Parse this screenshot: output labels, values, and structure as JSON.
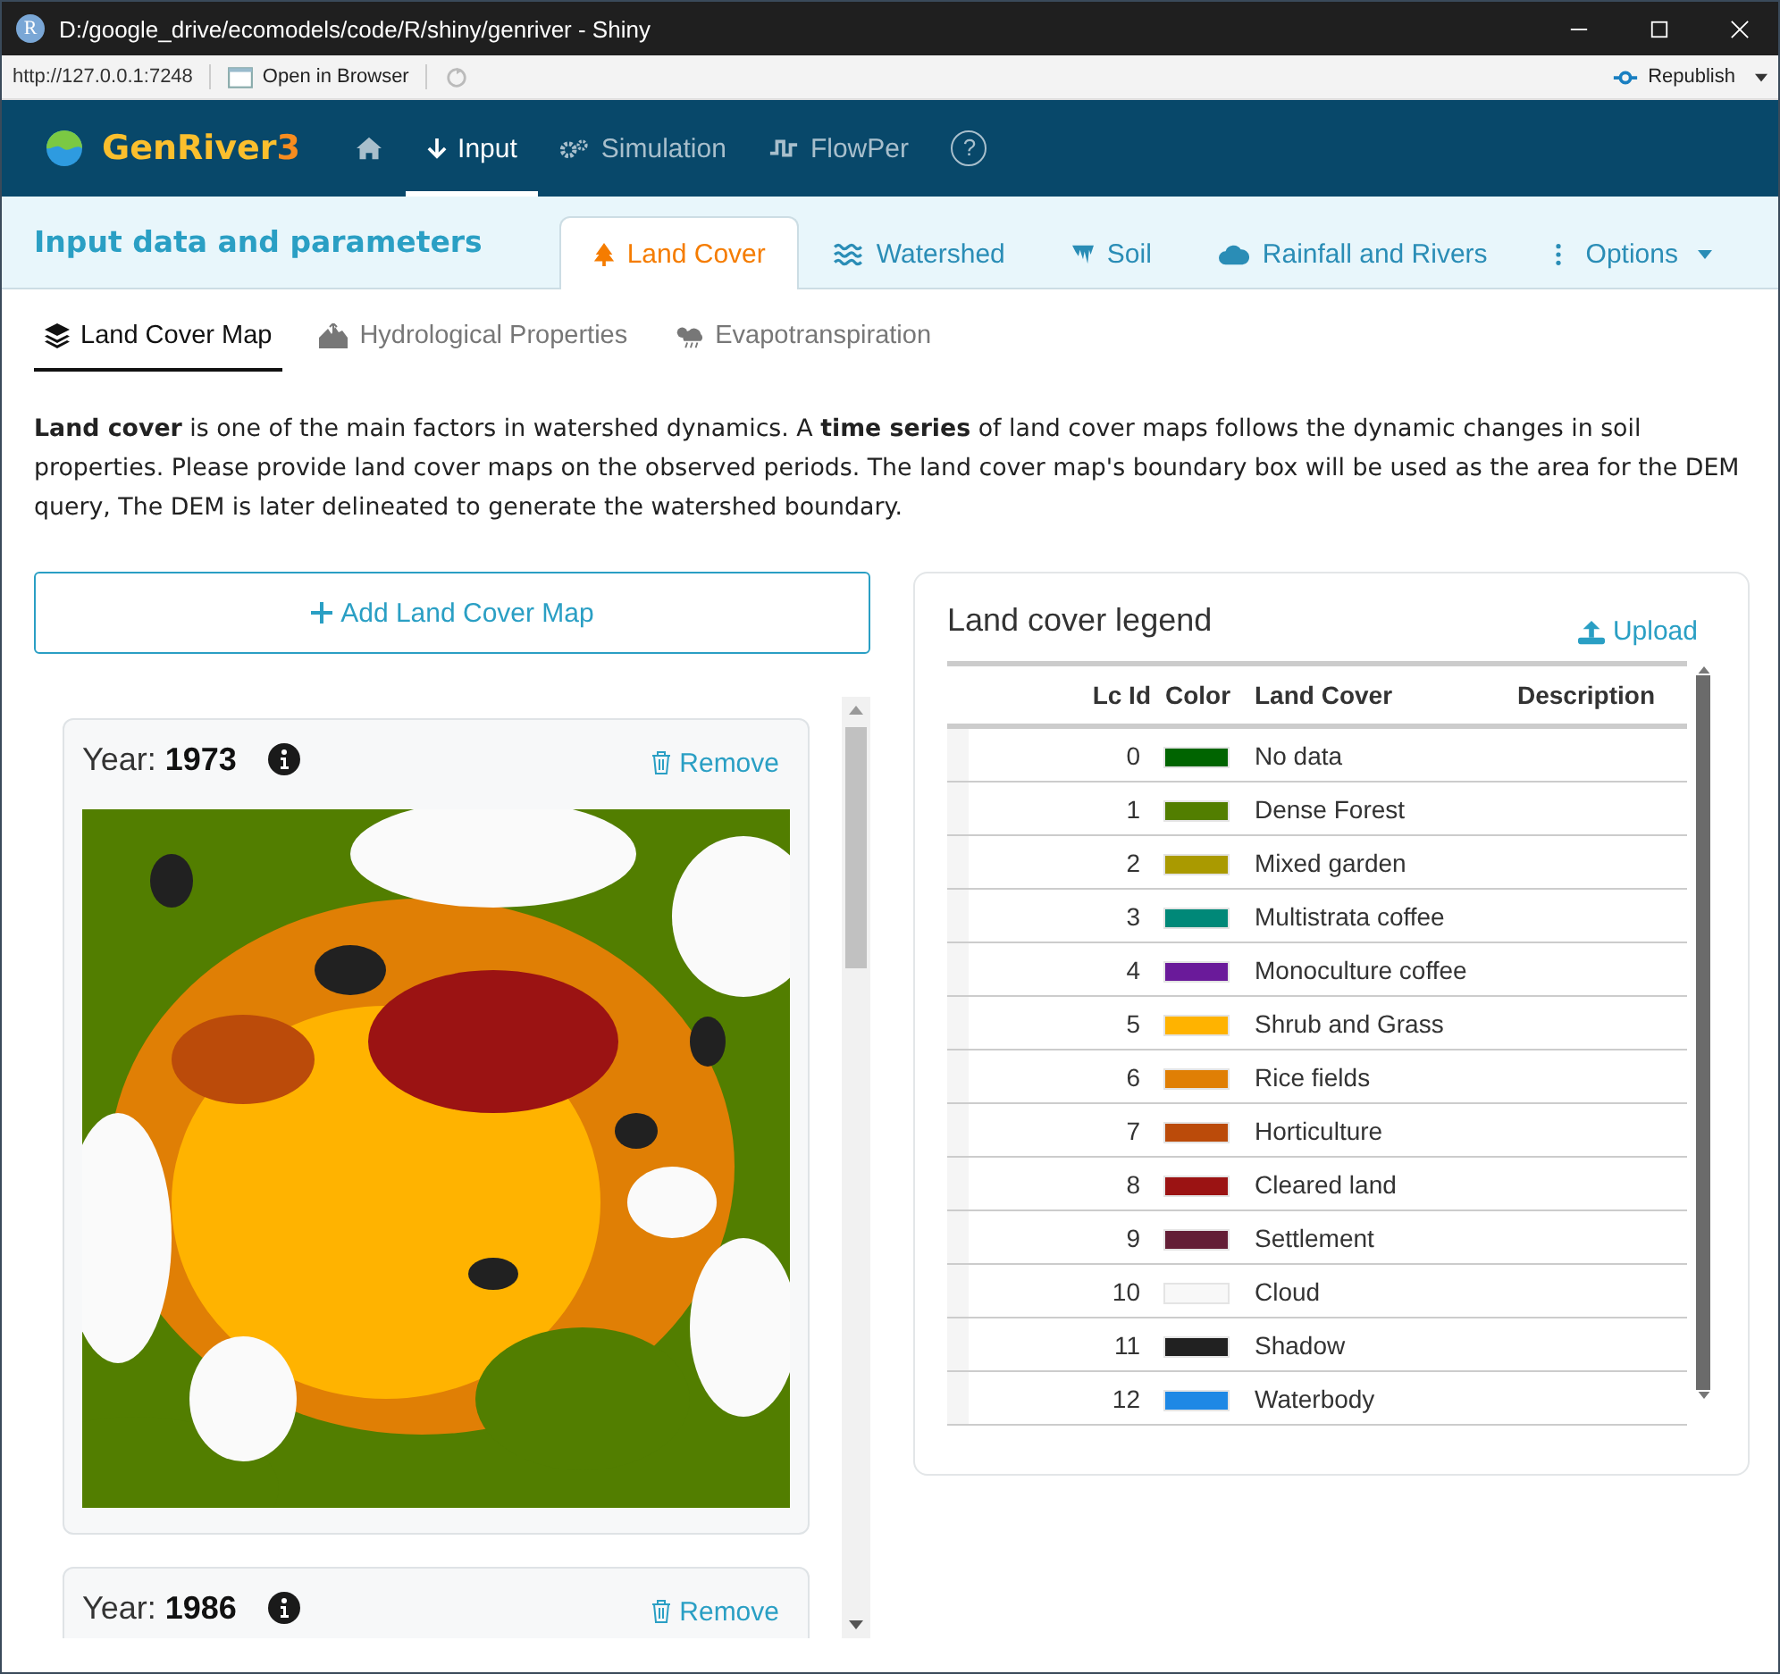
{
  "window": {
    "app_icon": "R",
    "title": "D:/google_drive/ecomodels/code/R/shiny/genriver - Shiny",
    "url": "http://127.0.0.1:7248",
    "open_in_browser": "Open in Browser",
    "republish": "Republish"
  },
  "navbar": {
    "brand": "GenRiver",
    "brand_number": "3",
    "items": [
      {
        "kind": "home",
        "selected": false
      },
      {
        "kind": "link",
        "label": "Input",
        "selected": true
      },
      {
        "kind": "link",
        "label": "Simulation",
        "selected": false
      },
      {
        "kind": "link",
        "label": "FlowPer",
        "selected": false
      },
      {
        "kind": "help",
        "glyph": "?",
        "selected": false
      }
    ]
  },
  "header": {
    "title": "Input data and parameters",
    "tabs": [
      {
        "label": "Land Cover",
        "selected": true
      },
      {
        "label": "Watershed",
        "selected": false
      },
      {
        "label": "Soil",
        "selected": false
      },
      {
        "label": "Rainfall and Rivers",
        "selected": false
      }
    ],
    "options": "Options"
  },
  "subtabs": [
    {
      "label": "Land Cover Map",
      "selected": true
    },
    {
      "label": "Hydrological Properties",
      "selected": false
    },
    {
      "label": "Evapotranspiration",
      "selected": false
    }
  ],
  "description": "**Land cover** is one of the main factors in watershed dynamics. A **time series** of land cover maps follows the dynamic changes in soil properties. Please provide land cover maps on the observed periods. The land cover map's boundary box will be used as the area for the DEM query, The DEM is later delineated to generate the watershed boundary.",
  "add_button": "Add Land Cover Map",
  "maps": [
    {
      "label": "Year:",
      "year": "1973",
      "remove": "Remove"
    },
    {
      "label": "Year:",
      "year": "1986",
      "remove": "Remove"
    }
  ],
  "legend": {
    "title": "Land cover legend",
    "upload": "Upload",
    "columns": [
      "Lc Id",
      "Color",
      "Land Cover",
      "Description"
    ],
    "rows": [
      {
        "id": "0",
        "color": "#006400",
        "name": "No data"
      },
      {
        "id": "1",
        "color": "#527e00",
        "name": "Dense Forest"
      },
      {
        "id": "2",
        "color": "#aa9a00",
        "name": "Mixed garden"
      },
      {
        "id": "3",
        "color": "#008878",
        "name": "Multistrata coffee"
      },
      {
        "id": "4",
        "color": "#6a1a9a",
        "name": "Monoculture coffee"
      },
      {
        "id": "5",
        "color": "#ffb300",
        "name": "Shrub and Grass"
      },
      {
        "id": "6",
        "color": "#e07f05",
        "name": "Rice fields"
      },
      {
        "id": "7",
        "color": "#bb4b0a",
        "name": "Horticulture"
      },
      {
        "id": "8",
        "color": "#9b1313",
        "name": "Cleared land"
      },
      {
        "id": "9",
        "color": "#631e36",
        "name": "Settlement"
      },
      {
        "id": "10",
        "color": "#f8f8f8",
        "name": "Cloud"
      },
      {
        "id": "11",
        "color": "#212121",
        "name": "Shadow"
      },
      {
        "id": "12",
        "color": "#1e88e5",
        "name": "Waterbody"
      }
    ]
  }
}
